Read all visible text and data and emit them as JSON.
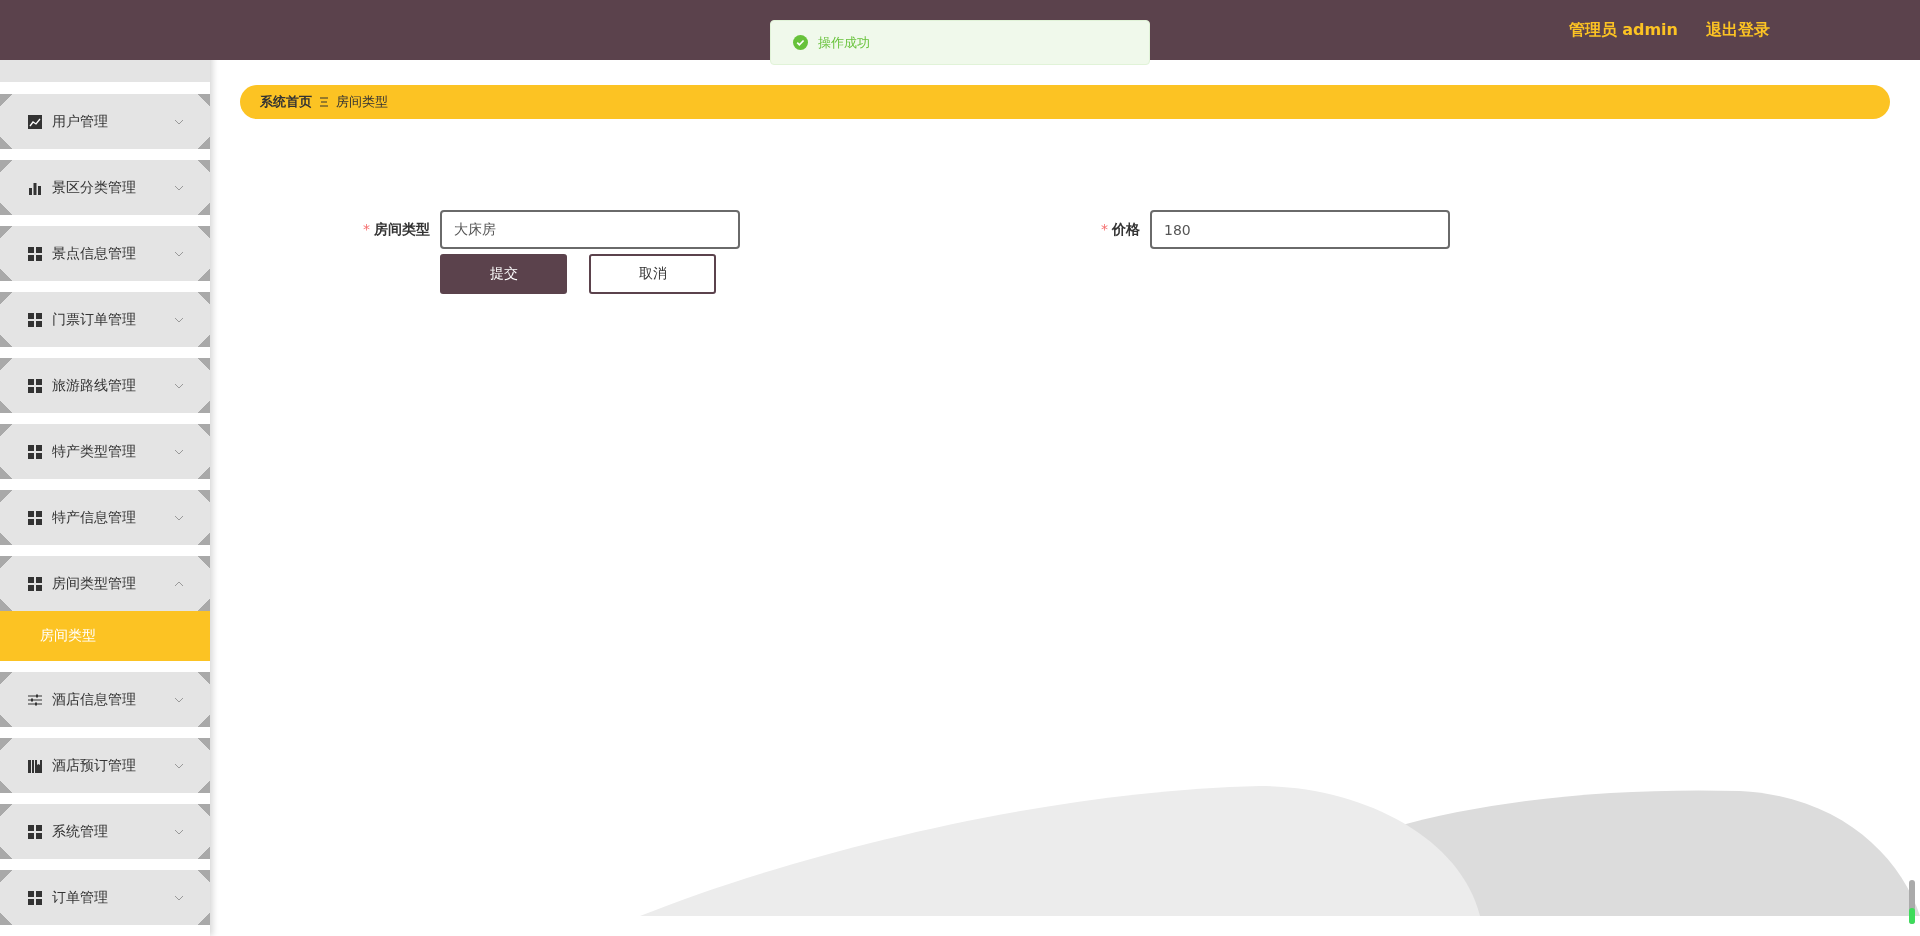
{
  "header": {
    "user_label": "管理员 admin",
    "logout": "退出登录"
  },
  "toast": {
    "kind": "success",
    "message": "操作成功"
  },
  "sidebar": {
    "items": [
      {
        "label": "用户管理",
        "kind": "trend",
        "expanded": false
      },
      {
        "label": "景区分类管理",
        "kind": "bars",
        "expanded": false
      },
      {
        "label": "景点信息管理",
        "kind": "grid",
        "expanded": false
      },
      {
        "label": "门票订单管理",
        "kind": "grid",
        "expanded": false
      },
      {
        "label": "旅游路线管理",
        "kind": "grid",
        "expanded": false
      },
      {
        "label": "特产类型管理",
        "kind": "grid",
        "expanded": false
      },
      {
        "label": "特产信息管理",
        "kind": "grid",
        "expanded": false
      },
      {
        "label": "房间类型管理",
        "kind": "grid",
        "expanded": true,
        "children": [
          {
            "label": "房间类型",
            "selected": true
          }
        ]
      },
      {
        "label": "酒店信息管理",
        "kind": "sliders",
        "expanded": false
      },
      {
        "label": "酒店预订管理",
        "kind": "books",
        "expanded": false
      },
      {
        "label": "系统管理",
        "kind": "grid",
        "expanded": false
      },
      {
        "label": "订单管理",
        "kind": "grid",
        "expanded": false
      }
    ]
  },
  "breadcrumb": [
    {
      "label": "系统首页"
    },
    {
      "label": "房间类型"
    }
  ],
  "form": {
    "fields": [
      {
        "required_mark": "*",
        "label": "房间类型",
        "value": "大床房"
      },
      {
        "required_mark": "*",
        "label": "价格",
        "value": "180"
      }
    ],
    "buttons": [
      {
        "label": "提交",
        "kind": "primary"
      },
      {
        "label": "取消",
        "kind": "plain"
      }
    ]
  }
}
